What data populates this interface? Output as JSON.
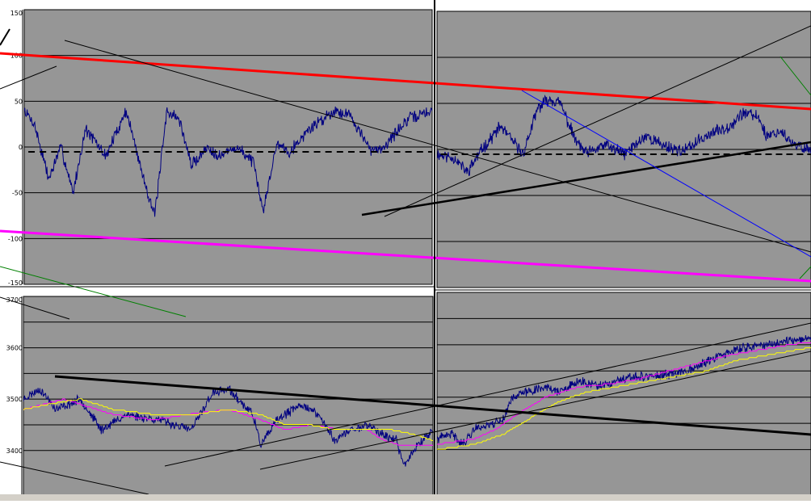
{
  "colors": {
    "plot_bg": "#969696",
    "series": "#000080",
    "grid": "#000000",
    "channel_red": "#ff0000",
    "channel_magenta": "#ff00ff",
    "trend_black": "#000000",
    "trend_blue": "#0000ff",
    "trend_green": "#008000",
    "ma_magenta": "#ff00ff",
    "ma_yellow": "#ffff00"
  },
  "chart_data": [
    {
      "type": "line",
      "panel": "top-left",
      "title": "",
      "xlabel": "",
      "ylabel": "",
      "grid": true,
      "ylim": [
        -150,
        150
      ],
      "yticks": [
        "150",
        "100",
        "50",
        "0",
        "-50",
        "-100",
        "-150"
      ],
      "xlim": [
        0,
        1000
      ],
      "seed": 7,
      "series": [
        {
          "anchors": [
            [
              0,
              40
            ],
            [
              25,
              25
            ],
            [
              60,
              -35
            ],
            [
              90,
              0
            ],
            [
              120,
              -50
            ],
            [
              150,
              20
            ],
            [
              200,
              -10
            ],
            [
              250,
              40
            ],
            [
              290,
              -30
            ],
            [
              320,
              -75
            ],
            [
              350,
              40
            ],
            [
              380,
              30
            ],
            [
              410,
              -20
            ],
            [
              450,
              0
            ],
            [
              480,
              -10
            ],
            [
              520,
              0
            ],
            [
              560,
              -15
            ],
            [
              585,
              -70
            ],
            [
              620,
              5
            ],
            [
              650,
              -5
            ],
            [
              700,
              20
            ],
            [
              760,
              40
            ],
            [
              800,
              35
            ],
            [
              850,
              -5
            ],
            [
              880,
              0
            ],
            [
              920,
              20
            ],
            [
              940,
              30
            ],
            [
              1000,
              40
            ]
          ]
        }
      ]
    },
    {
      "type": "line",
      "panel": "top-right",
      "title": "",
      "xlabel": "",
      "ylabel": "",
      "grid": true,
      "ylim": [
        -150,
        150
      ],
      "xlim": [
        0,
        1000
      ],
      "seed": 11,
      "series": [
        {
          "anchors": [
            [
              0,
              -5
            ],
            [
              50,
              -10
            ],
            [
              80,
              -25
            ],
            [
              120,
              0
            ],
            [
              170,
              25
            ],
            [
              230,
              -5
            ],
            [
              270,
              45
            ],
            [
              300,
              55
            ],
            [
              330,
              50
            ],
            [
              370,
              10
            ],
            [
              400,
              -5
            ],
            [
              450,
              5
            ],
            [
              500,
              -5
            ],
            [
              560,
              15
            ],
            [
              600,
              5
            ],
            [
              660,
              -2
            ],
            [
              720,
              15
            ],
            [
              780,
              25
            ],
            [
              820,
              40
            ],
            [
              860,
              35
            ],
            [
              880,
              15
            ],
            [
              920,
              20
            ],
            [
              950,
              5
            ],
            [
              1000,
              0
            ]
          ]
        }
      ]
    },
    {
      "type": "line",
      "panel": "bottom-left",
      "title": "",
      "xlabel": "",
      "ylabel": "",
      "grid": true,
      "ylim": [
        3310,
        3700
      ],
      "yticks": [
        "3700",
        "3600",
        "3500",
        "3400"
      ],
      "xlim": [
        0,
        1000
      ],
      "seed": 23,
      "series": [
        {
          "name": "",
          "anchors": [
            [
              0,
              3500
            ],
            [
              40,
              3520
            ],
            [
              80,
              3480
            ],
            [
              140,
              3500
            ],
            [
              190,
              3440
            ],
            [
              250,
              3470
            ],
            [
              330,
              3460
            ],
            [
              410,
              3440
            ],
            [
              460,
              3510
            ],
            [
              500,
              3520
            ],
            [
              560,
              3470
            ],
            [
              580,
              3410
            ],
            [
              620,
              3460
            ],
            [
              680,
              3490
            ],
            [
              720,
              3470
            ],
            [
              760,
              3420
            ],
            [
              800,
              3440
            ],
            [
              840,
              3450
            ],
            [
              880,
              3430
            ],
            [
              910,
              3420
            ],
            [
              930,
              3370
            ],
            [
              960,
              3410
            ],
            [
              1000,
              3440
            ]
          ]
        },
        {
          "name": "",
          "anchors": [
            [
              0,
              3480
            ],
            [
              100,
              3500
            ],
            [
              220,
              3470
            ],
            [
              320,
              3460
            ],
            [
              400,
              3470
            ],
            [
              500,
              3480
            ],
            [
              580,
              3460
            ],
            [
              640,
              3440
            ],
            [
              700,
              3450
            ],
            [
              780,
              3440
            ],
            [
              840,
              3440
            ],
            [
              880,
              3420
            ],
            [
              920,
              3410
            ],
            [
              960,
              3410
            ],
            [
              1000,
              3410
            ]
          ]
        },
        {
          "name": "",
          "anchors": [
            [
              0,
              3480
            ],
            [
              60,
              3490
            ],
            [
              140,
              3500
            ],
            [
              220,
              3480
            ],
            [
              320,
              3470
            ],
            [
              420,
              3470
            ],
            [
              500,
              3480
            ],
            [
              580,
              3470
            ],
            [
              640,
              3450
            ],
            [
              700,
              3450
            ],
            [
              760,
              3440
            ],
            [
              820,
              3440
            ],
            [
              900,
              3440
            ],
            [
              960,
              3430
            ],
            [
              1000,
              3420
            ]
          ]
        }
      ]
    },
    {
      "type": "line",
      "panel": "bottom-right",
      "title": "",
      "xlabel": "",
      "ylabel": "",
      "grid": true,
      "ylim": [
        3310,
        3700
      ],
      "xlim": [
        0,
        1000
      ],
      "seed": 41,
      "series": [
        {
          "name": "",
          "anchors": [
            [
              0,
              3420
            ],
            [
              40,
              3430
            ],
            [
              70,
              3410
            ],
            [
              100,
              3440
            ],
            [
              150,
              3450
            ],
            [
              180,
              3460
            ],
            [
              200,
              3500
            ],
            [
              240,
              3510
            ],
            [
              290,
              3520
            ],
            [
              330,
              3510
            ],
            [
              380,
              3530
            ],
            [
              440,
              3520
            ],
            [
              480,
              3530
            ],
            [
              540,
              3540
            ],
            [
              600,
              3540
            ],
            [
              660,
              3550
            ],
            [
              700,
              3560
            ],
            [
              760,
              3580
            ],
            [
              800,
              3590
            ],
            [
              860,
              3600
            ],
            [
              900,
              3600
            ],
            [
              940,
              3610
            ],
            [
              1000,
              3610
            ]
          ]
        },
        {
          "name": "",
          "anchors": [
            [
              0,
              3410
            ],
            [
              100,
              3420
            ],
            [
              160,
              3440
            ],
            [
              220,
              3470
            ],
            [
              290,
              3500
            ],
            [
              380,
              3520
            ],
            [
              460,
              3525
            ],
            [
              540,
              3535
            ],
            [
              620,
              3550
            ],
            [
              700,
              3565
            ],
            [
              780,
              3580
            ],
            [
              860,
              3590
            ],
            [
              940,
              3600
            ],
            [
              1000,
              3605
            ]
          ]
        },
        {
          "name": "",
          "anchors": [
            [
              0,
              3400
            ],
            [
              100,
              3410
            ],
            [
              180,
              3430
            ],
            [
              250,
              3460
            ],
            [
              320,
              3490
            ],
            [
              400,
              3510
            ],
            [
              480,
              3520
            ],
            [
              560,
              3530
            ],
            [
              640,
              3540
            ],
            [
              720,
              3550
            ],
            [
              800,
              3570
            ],
            [
              880,
              3580
            ],
            [
              960,
              3590
            ],
            [
              1000,
              3595
            ]
          ]
        }
      ]
    }
  ]
}
